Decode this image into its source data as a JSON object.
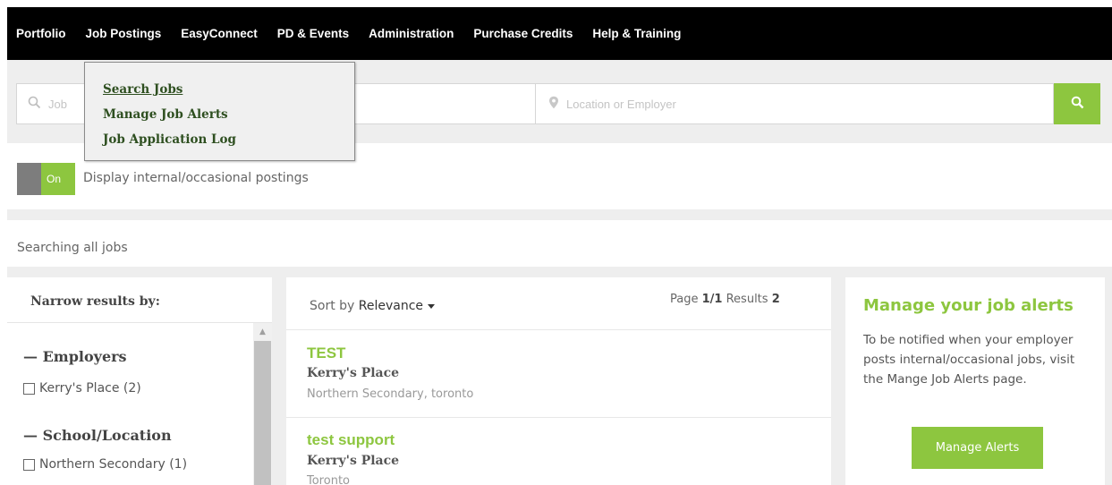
{
  "nav": {
    "items": [
      "Portfolio",
      "Job Postings",
      "EasyConnect",
      "PD & Events",
      "Administration",
      "Purchase Credits",
      "Help & Training"
    ]
  },
  "dropdown": {
    "items": [
      "Search Jobs",
      "Manage Job Alerts",
      "Job Application Log"
    ]
  },
  "search": {
    "job_placeholder": "Job",
    "location_placeholder": "Location or Employer"
  },
  "toggle": {
    "state_label": "On",
    "label": "Display internal/occasional postings"
  },
  "searching_text": "Searching all jobs",
  "filters": {
    "title": "Narrow results by:",
    "sections": [
      {
        "title": "Employers",
        "options": [
          "Kerry's Place (2)"
        ]
      },
      {
        "title": "School/Location",
        "options": [
          "Northern Secondary (1)"
        ]
      }
    ]
  },
  "results": {
    "sort_prefix": "Sort by",
    "sort_value": "Relevance",
    "page_prefix": "Page",
    "page_value": "1/1",
    "results_prefix": "Results",
    "results_count": "2",
    "jobs": [
      {
        "title": "TEST",
        "employer": "Kerry's Place",
        "location": "Northern Secondary, toronto"
      },
      {
        "title": "test support",
        "employer": "Kerry's Place",
        "location": "Toronto"
      }
    ]
  },
  "alerts": {
    "title": "Manage your job alerts",
    "description": "To be notified when your employer posts internal/occasional jobs, visit the Mange Job Alerts page.",
    "button": "Manage Alerts"
  },
  "colors": {
    "accent": "#8dc63f",
    "nav_bg": "#000000",
    "dropdown_text": "#2e4f20"
  },
  "icons": {
    "search": "search-icon",
    "location": "map-pin-icon",
    "dash": "dash-icon"
  }
}
